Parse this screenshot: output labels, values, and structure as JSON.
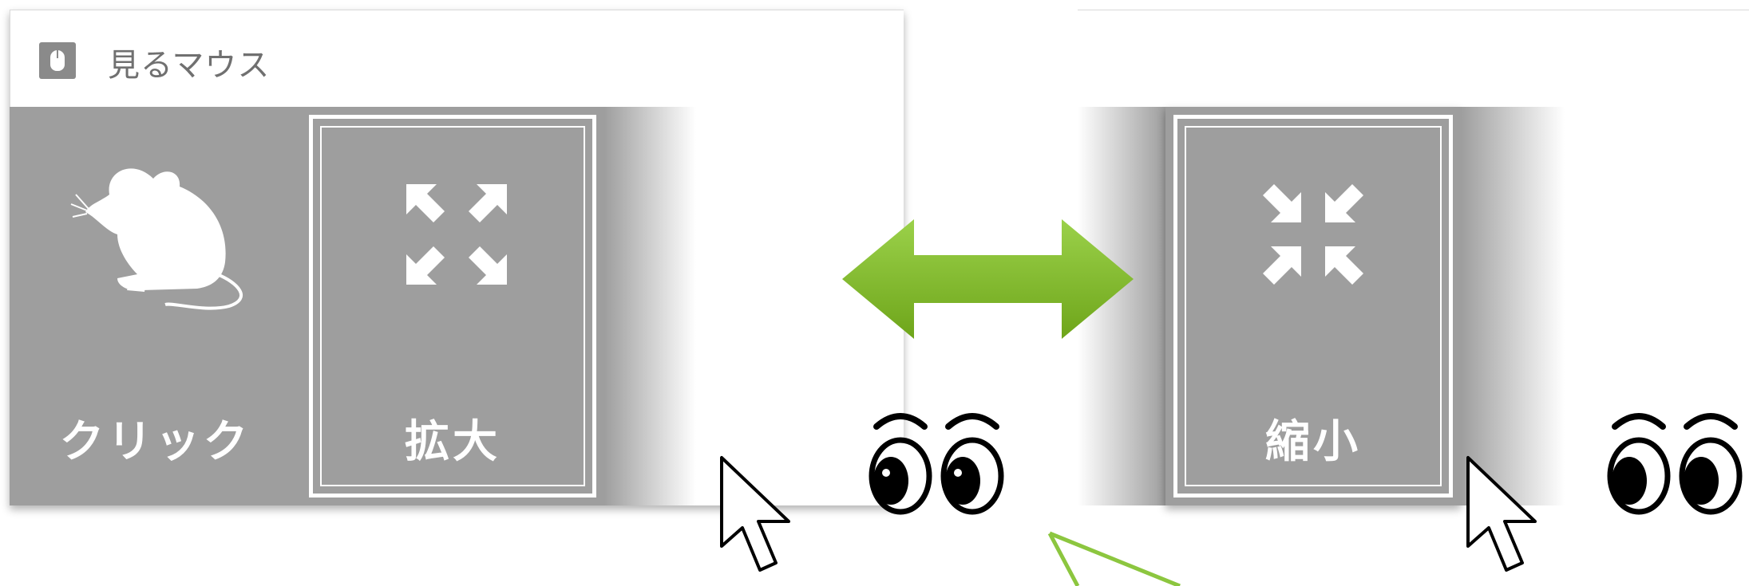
{
  "app": {
    "title": "見るマウス",
    "icon": "mouse-app-icon"
  },
  "tiles_left": [
    {
      "label": "クリック",
      "icon": "mouse-animal-icon",
      "selected": false
    },
    {
      "label": "拡大",
      "icon": "expand-arrows-icon",
      "selected": true
    }
  ],
  "tiles_right": [
    {
      "label": "縮小",
      "icon": "shrink-arrows-icon",
      "selected": true
    }
  ],
  "annotation": {
    "swap_arrow_color": "#7ab51d",
    "eyes": "eyes-icon",
    "pointer": "mouse-pointer-icon"
  },
  "colors": {
    "tile_bg": "#9e9e9e",
    "tile_text": "#ffffff",
    "accent_green": "#8cc63f"
  }
}
